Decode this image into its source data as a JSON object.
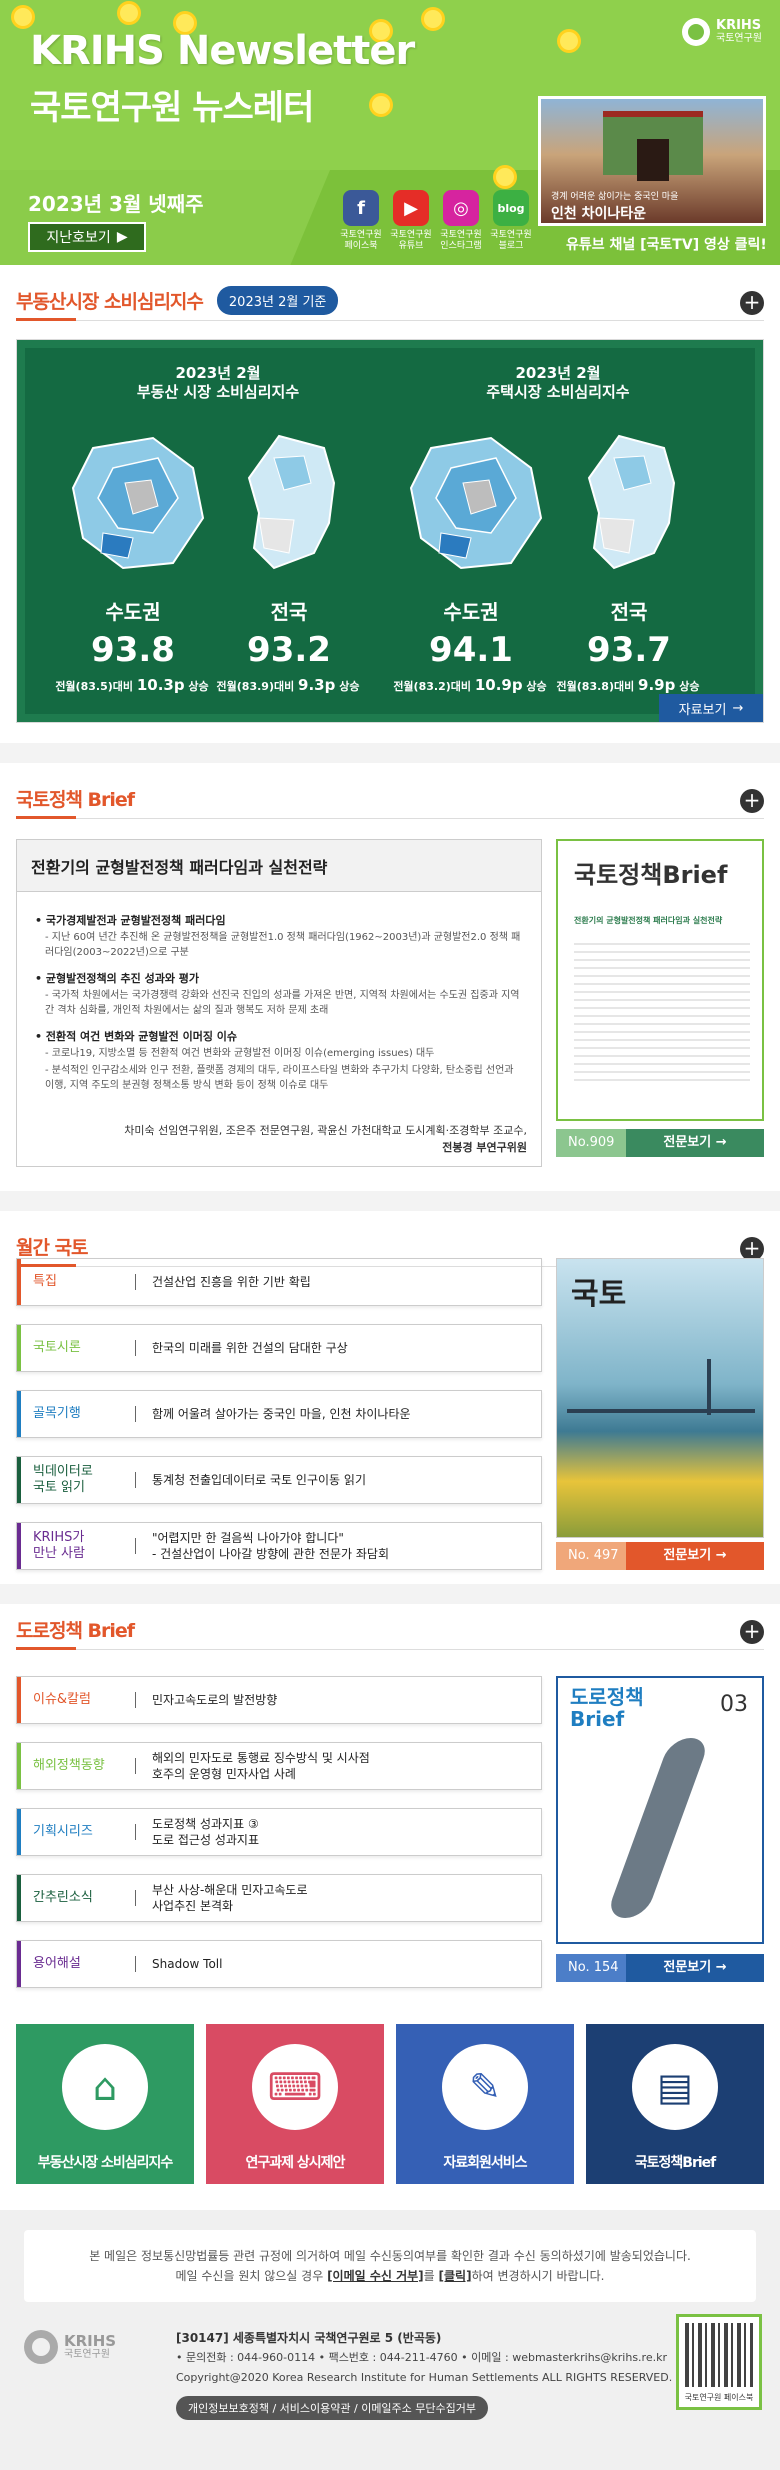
{
  "header": {
    "title": "KRIHS Newsletter",
    "subtitle": "국토연구원 뉴스레터",
    "date": "2023년 3월 넷째주",
    "prev_button": "지난호보기",
    "logo_en": "KRIHS",
    "logo_ko": "국토연구원",
    "social": [
      {
        "label": "국토연구원\n페이스북",
        "glyph": "f",
        "color": "#3b5998"
      },
      {
        "label": "국토연구원\n유튜브",
        "glyph": "▶",
        "color": "#e52d27"
      },
      {
        "label": "국토연구원\n인스타그램",
        "glyph": "◎",
        "color": "#d6249f"
      },
      {
        "label": "국토연구원\n블로그",
        "glyph": "blog",
        "color": "#3cb043"
      }
    ],
    "photo_caption_small": "경계 어려운 삶이가는 중국인 마을",
    "photo_caption_big": "인천 차이나타운",
    "youtube_text": "유튜브 채널 [국토TV] 영상 클릭!"
  },
  "survey": {
    "section_title": "부동산시장 소비심리지수",
    "badge": "2023년 2월 기준",
    "left_heading": "2023년 2월\n부동산 시장 소비심리지수",
    "right_heading": "2023년 2월\n주택시장 소비심리지수",
    "panels": [
      {
        "region": "수도권",
        "value": "93.8",
        "note_a": "전월(83.5)대비",
        "note_b": "10.3p",
        "note_c": "상승"
      },
      {
        "region": "전국",
        "value": "93.2",
        "note_a": "전월(83.9)대비",
        "note_b": "9.3p",
        "note_c": "상승"
      },
      {
        "region": "수도권",
        "value": "94.1",
        "note_a": "전월(83.2)대비",
        "note_b": "10.9p",
        "note_c": "상승"
      },
      {
        "region": "전국",
        "value": "93.7",
        "note_a": "전월(83.8)대비",
        "note_b": "9.9p",
        "note_c": "상승"
      }
    ],
    "more": "자료보기"
  },
  "brief": {
    "section_title": "국토정책 Brief",
    "headline": "전환기의 균형발전정책 패러다임과 실천전략",
    "items": [
      {
        "title": "국가경제발전과 균형발전정책 패러다임",
        "text": "- 지난 60여 년간 추진해 온 균형발전정책을 균형발전1.0 정책 패러다임(1962~2003년)과 균형발전2.0 정책 패러다임(2003~2022년)으로 구분"
      },
      {
        "title": "균형발전정책의 추진 성과와 평가",
        "text": "- 국가적 차원에서는 국가경쟁력 강화와 선진국 진입의 성과를 가져온 반면, 지역적 차원에서는 수도권 집중과 지역 간 격차 심화를, 개인적 차원에서는 삶의 질과 행복도 저하 문제 초래"
      },
      {
        "title": "전환적 여건 변화와 균형발전 이머징 이슈",
        "text": "- 코로나19, 지방소멸 등 전환적 여건 변화와 균형발전 이머징 이슈(emerging issues) 대두\n- 분석적인 인구감소세와 인구 전환, 플랫폼 경제의 대두, 라이프스타일 변화와 추구가치 다양화, 탄소중립 선언과 이행, 지역 주도의 분권형 정책소통 방식 변화 등이 정책 이슈로 대두"
      }
    ],
    "authors_line1": "차미숙 선임연구위원, 조은주 전문연구원, 곽윤신 가천대학교 도시계획·조경학부 조교수,",
    "authors_line2": "전봉경 부연구위원",
    "cover_title": "국토정책Brief",
    "cover_subtitle": "전환기의 균형발전정책 패러다임과 실천전략",
    "issue": "No.909",
    "view": "전문보기"
  },
  "monthly": {
    "section_title": "월간 국토",
    "rows": [
      {
        "cat": "특집",
        "val": "건설산업 진흥을 위한 기반 확립",
        "color": "#e2572b"
      },
      {
        "cat": "국토시론",
        "val": "한국의 미래를 위한 건설의 담대한 구상",
        "color": "#7ac143"
      },
      {
        "cat": "골목기행",
        "val": "함께 어울려 살아가는 중국인 마을, 인천 차이나타운",
        "color": "#1f7ec1"
      },
      {
        "cat": "빅데이터로\n국토 읽기",
        "val": "통계청 전출입데이터로 국토 인구이동 읽기",
        "color": "#1a5f3e"
      },
      {
        "cat": "KRIHS가\n만난 사람",
        "val": "\"어렵지만 한 걸음씩 나아가야 합니다\"\n-  건설산업이 나아갈 방향에 관한 전문가 좌담회",
        "color": "#6a2c91"
      }
    ],
    "cover_title": "국토",
    "issue": "No. 497",
    "view": "전문보기"
  },
  "road": {
    "section_title": "도로정책 Brief",
    "rows": [
      {
        "cat": "이슈&칼럼",
        "val": "민자고속도로의 발전방향",
        "color": "#e2572b"
      },
      {
        "cat": "해외정책동향",
        "val": "해외의 민자도로 통행료 징수방식 및 시사점\n호주의 운영형 민자사업 사례",
        "color": "#7ac143"
      },
      {
        "cat": "기획시리즈",
        "val": "도로정책 성과지표 ③\n도로 접근성 성과지표",
        "color": "#1f7ec1"
      },
      {
        "cat": "간추린소식",
        "val": "부산 사상-해운대 민자고속도로\n사업추진 본격화",
        "color": "#1a5f3e"
      },
      {
        "cat": "용어해설",
        "val": "Shadow Toll",
        "color": "#6a2c91"
      }
    ],
    "cover_title": "도로정책\nBrief",
    "cover_no": "03",
    "issue": "No. 154",
    "view": "전문보기"
  },
  "tiles": [
    {
      "label": "부동산시장 소비심리지수",
      "icon": "house-coin-icon",
      "glyph": "⌂",
      "color": "#2e9a62"
    },
    {
      "label": "연구과제 상시제안",
      "icon": "keyboard-icon",
      "glyph": "⌨",
      "color": "#d94b63"
    },
    {
      "label": "자료회원서비스",
      "icon": "notepad-icon",
      "glyph": "✎",
      "color": "#3560b5"
    },
    {
      "label": "국토정책Brief",
      "icon": "brief-icon",
      "glyph": "▤",
      "color": "#1c3f73"
    }
  ],
  "footer": {
    "notice_line1": "본 메일은 정보통신망법률등 관련 규정에 의거하여 메일 수신동의여부를 확인한 결과 수신 동의하셨기에 발송되었습니다.",
    "notice_pre": "메일 수신을 원치 않으실 경우 ",
    "notice_unsub": "[이메일 수신 거부]",
    "notice_mid": "를 ",
    "notice_click": "[클릭]",
    "notice_post": "하여 변경하시기 바랍니다.",
    "address": "[30147] 세종특별자치시 국책연구원로 5 (반곡동)",
    "contacts": "• 문의전화 : 044-960-0114   • 팩스번호 : 044-211-4760   • 이메일 : webmasterkrihs@krihs.re.kr",
    "copyright": "Copyright@2020 Korea Research Institute for Human Settlements ALL RIGHTS RESERVED.",
    "links": "개인정보보호정책 / 서비스이용약관 / 이메일주소 무단수집거부",
    "logo_en": "KRIHS",
    "logo_ko": "국토연구원",
    "qr_caption": "국토연구원 페이스북"
  }
}
